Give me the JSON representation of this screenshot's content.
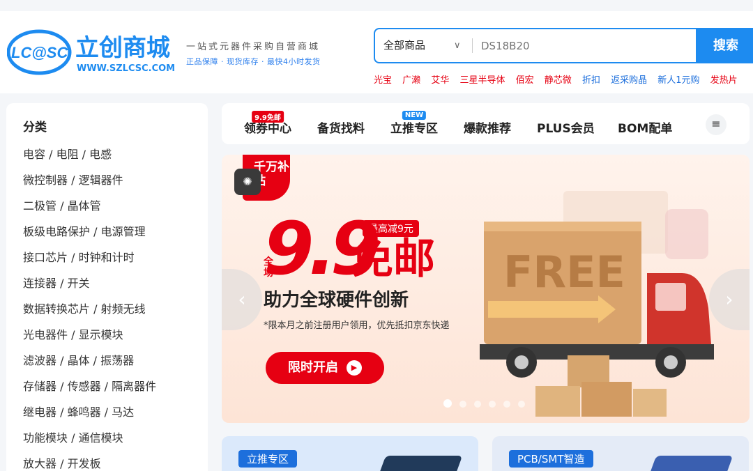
{
  "header": {
    "logo_left": "LC@SC",
    "logo_name": "立创商城",
    "logo_url": "WWW.SZLCSC.COM",
    "slogan_line1": "一站式元器件采购自营商城",
    "slogan_line2": "正品保障 · 现货库存 · 最快4小时发货"
  },
  "search": {
    "category": "全部商品",
    "placeholder": "DS18B20",
    "button": "搜索"
  },
  "hot_links": [
    {
      "label": "光宝",
      "color": "red"
    },
    {
      "label": "广濑",
      "color": "red"
    },
    {
      "label": "艾华",
      "color": "red"
    },
    {
      "label": "三星半导体",
      "color": "red"
    },
    {
      "label": "佰宏",
      "color": "red"
    },
    {
      "label": "静芯微",
      "color": "red"
    },
    {
      "label": "折扣",
      "color": "blue"
    },
    {
      "label": "返采购晶",
      "color": "blue"
    },
    {
      "label": "新人1元购",
      "color": "blue"
    },
    {
      "label": "发热片",
      "color": "red"
    }
  ],
  "sidebar": {
    "title": "分类",
    "items": [
      "电容 / 电阻 / 电感",
      "微控制器 / 逻辑器件",
      "二极管 / 晶体管",
      "板级电路保护 / 电源管理",
      "接口芯片 / 时钟和计时",
      "连接器 / 开关",
      "数据转换芯片 / 射频无线",
      "光电器件 / 显示模块",
      "滤波器 / 晶体 / 振荡器",
      "存储器 / 传感器 / 隔离器件",
      "继电器 / 蜂鸣器 / 马达",
      "功能模块 / 通信模块",
      "放大器 / 开发板"
    ]
  },
  "nav": {
    "items": [
      {
        "label": "领券中心",
        "badge": "9.9免邮",
        "badge_color": "red"
      },
      {
        "label": "备货找料",
        "badge": "",
        "badge_color": ""
      },
      {
        "label": "立推专区",
        "badge": "NEW",
        "badge_color": "blue"
      },
      {
        "label": "爆款推荐",
        "badge": "",
        "badge_color": ""
      },
      {
        "label": "PLUS会员",
        "badge": "",
        "badge_color": ""
      },
      {
        "label": "BOM配单",
        "badge": "",
        "badge_color": ""
      }
    ],
    "menu_icon": "list-icon"
  },
  "banner": {
    "tag": "千万补贴",
    "headline_number": "9.9",
    "headline_word": "免邮",
    "prefix": "全场",
    "pill": "最高减9元",
    "subtitle": "助力全球硬件创新",
    "note": "*限本月之前注册用户领用，优先抵扣京东快递",
    "cta": "限时开启",
    "truck_text": "FREE",
    "slide_count": 6,
    "active_slide": 1
  },
  "cards": [
    {
      "label": "立推专区"
    },
    {
      "label": "PCB/SMT智造"
    }
  ],
  "colors": {
    "brand_blue": "#1d8bf0",
    "brand_red": "#e60012"
  }
}
